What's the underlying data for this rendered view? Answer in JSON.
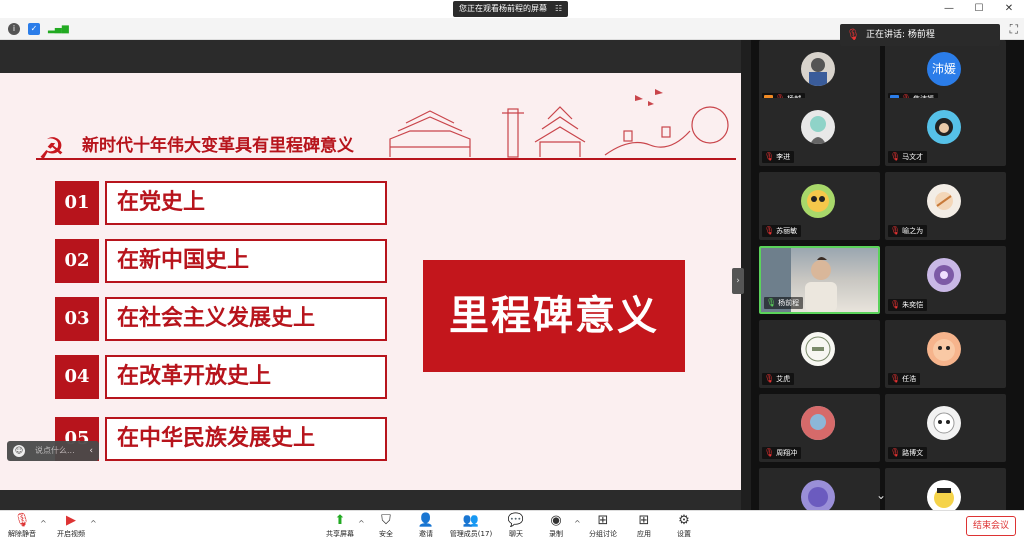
{
  "titlebar": {
    "share_label": "您正在观看杨前程的屏幕",
    "win_min": "—",
    "win_max": "☐",
    "win_close": "✕"
  },
  "speaking": {
    "label": "正在讲话: 杨前程"
  },
  "slide": {
    "title": "新时代十年伟大变革具有里程碑意义",
    "items": [
      {
        "num": "01",
        "text": "在党史上"
      },
      {
        "num": "02",
        "text": "在新中国史上"
      },
      {
        "num": "03",
        "text": "在社会主义发展史上"
      },
      {
        "num": "04",
        "text": "在改革开放史上"
      },
      {
        "num": "05",
        "text": "在中华民族发展史上"
      }
    ],
    "highlight": "里程碑意义"
  },
  "chat": {
    "placeholder": "说点什么..."
  },
  "participants": [
    {
      "name": "杨越",
      "host": true
    },
    {
      "name": "焦沛媛",
      "host": true,
      "avatar_text": "沛媛"
    },
    {
      "name": "李进"
    },
    {
      "name": "马文才"
    },
    {
      "name": "苏丽敏"
    },
    {
      "name": "喻之为"
    },
    {
      "name": "杨前程",
      "active": true
    },
    {
      "name": "朱奕恺"
    },
    {
      "name": "艾虎"
    },
    {
      "name": "任浩"
    },
    {
      "name": "周翔冲"
    },
    {
      "name": "路博文"
    }
  ],
  "toolbar": {
    "mute": "解除静音",
    "video": "开启视频",
    "share": "共享屏幕",
    "security": "安全",
    "invite": "邀请",
    "members": "管理成员(17)",
    "chat": "聊天",
    "record": "录制",
    "breakout": "分组讨论",
    "apps": "应用",
    "settings": "设置",
    "end": "结束会议"
  },
  "colors": {
    "accent_red": "#b7141c",
    "highlight_red": "#c3161c",
    "slide_bg": "#fbeff0",
    "active_border": "#5bd35b"
  }
}
